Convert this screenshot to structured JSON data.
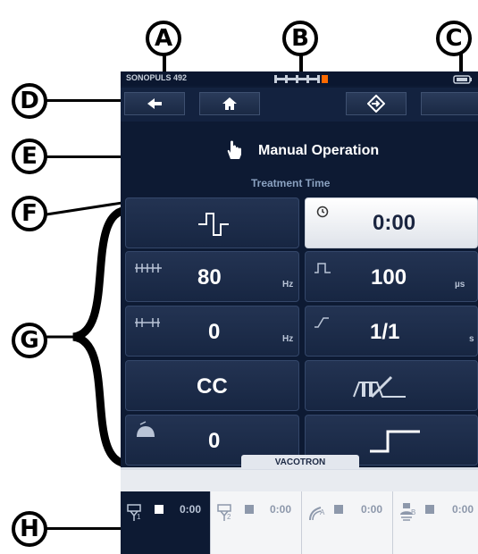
{
  "callouts": {
    "a": "A",
    "b": "B",
    "c": "C",
    "d": "D",
    "e": "E",
    "f": "F",
    "g": "G",
    "h": "H"
  },
  "device": {
    "model_name": "SONOPULS 492",
    "title": "Manual Operation",
    "subtitle": "Treatment Time",
    "footer_label": "VACOTRON"
  },
  "cells": {
    "treatment_time": "0:00",
    "frequency": {
      "value": "80",
      "unit": "Hz"
    },
    "pulse_duration": {
      "value": "100",
      "unit": "µs"
    },
    "modulation": {
      "value": "0",
      "unit": "Hz"
    },
    "ratio": {
      "value": "1/1",
      "unit": "s"
    },
    "mode": "CC",
    "vacuum": "0"
  },
  "channels": [
    {
      "letter": "1",
      "time": "0:00"
    },
    {
      "letter": "2",
      "time": "0:00"
    },
    {
      "letter": "A",
      "time": "0:00"
    },
    {
      "letter": "B",
      "time": "0:00"
    }
  ],
  "colors": {
    "background": "#0d1a33",
    "accent": "#ff6a00",
    "selected": "#ffffff",
    "subtitle": "#8aa1c0"
  },
  "icons": [
    "back-arrow-icon",
    "home-icon",
    "settings-icon",
    "hand-icon",
    "clock-icon",
    "pulse-waveform-icon",
    "ramp-icon",
    "bell-icon",
    "step-icon",
    "battery-icon"
  ]
}
